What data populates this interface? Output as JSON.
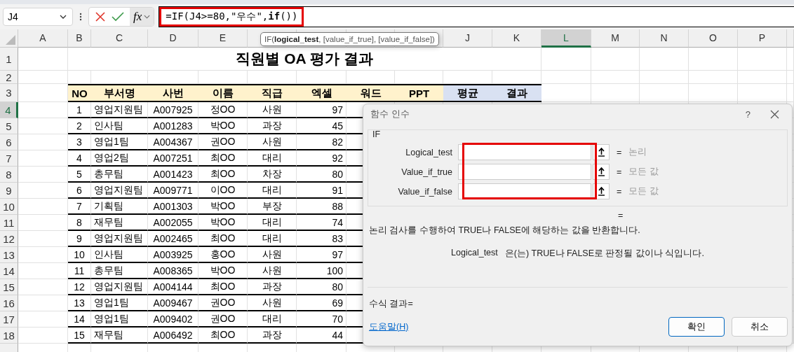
{
  "name_box": {
    "value": "J4"
  },
  "formula_bar": {
    "fx_label": "fx",
    "formula": "=IF(J4>=80,\"우수\",**if**())",
    "highlighted": true
  },
  "tooltip": {
    "text": "IF(**logical_test**, [value_if_true], [value_if_false])"
  },
  "column_headers_left": [
    {
      "label": "A",
      "selected": false
    },
    {
      "label": "B",
      "selected": false
    },
    {
      "label": "C",
      "selected": false
    },
    {
      "label": "D",
      "selected": false
    },
    {
      "label": "E",
      "selected": false
    }
  ],
  "column_headers_right": [
    {
      "label": "J",
      "selected": false
    },
    {
      "label": "K",
      "selected": false
    },
    {
      "label": "L",
      "selected": true
    },
    {
      "label": "M",
      "selected": false
    },
    {
      "label": "N",
      "selected": false
    },
    {
      "label": "O",
      "selected": false
    },
    {
      "label": "P",
      "selected": false
    }
  ],
  "rows": [
    {
      "number": "1",
      "selected": false,
      "kind": "title",
      "title": "직원별 OA 평가 결과"
    },
    {
      "number": "2",
      "selected": false,
      "kind": "blank"
    },
    {
      "number": "3",
      "selected": false,
      "kind": "header",
      "cells": [
        {
          "text": "NO",
          "color": "#fff2cc"
        },
        {
          "text": "부서명",
          "color": "#fff2cc"
        },
        {
          "text": "사번",
          "color": "#fff2cc"
        },
        {
          "text": "이름",
          "color": "#fff2cc"
        },
        {
          "text": "직급",
          "color": "#fff2cc"
        },
        {
          "text": "엑셀",
          "color": "#fff2cc"
        },
        {
          "text": "워드",
          "color": "#fff2cc"
        },
        {
          "text": "PPT",
          "color": "#fff2cc"
        },
        {
          "text": "평균",
          "color": "#d9e1f2"
        },
        {
          "text": "결과",
          "color": "#d9e1f2"
        }
      ]
    },
    {
      "number": "4",
      "selected": true,
      "kind": "data",
      "cells": [
        "1",
        "영업지원팀",
        "A007925",
        "정OO",
        "사원",
        "97"
      ]
    },
    {
      "number": "5",
      "selected": false,
      "kind": "data",
      "cells": [
        "2",
        "인사팀",
        "A001283",
        "박OO",
        "과장",
        "45"
      ]
    },
    {
      "number": "6",
      "selected": false,
      "kind": "data",
      "cells": [
        "3",
        "영업1팀",
        "A004367",
        "권OO",
        "사원",
        "82"
      ]
    },
    {
      "number": "7",
      "selected": false,
      "kind": "data",
      "cells": [
        "4",
        "영업2팀",
        "A007251",
        "최OO",
        "대리",
        "92"
      ]
    },
    {
      "number": "8",
      "selected": false,
      "kind": "data",
      "cells": [
        "5",
        "총무팀",
        "A001423",
        "최OO",
        "차장",
        "80"
      ]
    },
    {
      "number": "9",
      "selected": false,
      "kind": "data",
      "cells": [
        "6",
        "영업지원팀",
        "A009771",
        "이OO",
        "대리",
        "91"
      ]
    },
    {
      "number": "10",
      "selected": false,
      "kind": "data",
      "cells": [
        "7",
        "기획팀",
        "A001303",
        "박OO",
        "부장",
        "88"
      ]
    },
    {
      "number": "11",
      "selected": false,
      "kind": "data",
      "cells": [
        "8",
        "재무팀",
        "A002055",
        "박OO",
        "대리",
        "74"
      ]
    },
    {
      "number": "12",
      "selected": false,
      "kind": "data",
      "cells": [
        "9",
        "영업지원팀",
        "A002465",
        "최OO",
        "대리",
        "83"
      ]
    },
    {
      "number": "13",
      "selected": false,
      "kind": "data",
      "cells": [
        "10",
        "인사팀",
        "A003925",
        "홍OO",
        "사원",
        "97"
      ]
    },
    {
      "number": "14",
      "selected": false,
      "kind": "data",
      "cells": [
        "11",
        "총무팀",
        "A008365",
        "박OO",
        "사원",
        "100"
      ]
    },
    {
      "number": "15",
      "selected": false,
      "kind": "data",
      "cells": [
        "12",
        "영업지원팀",
        "A004144",
        "최OO",
        "과장",
        "80"
      ]
    },
    {
      "number": "16",
      "selected": false,
      "kind": "data",
      "cells": [
        "13",
        "영업1팀",
        "A009467",
        "권OO",
        "사원",
        "69"
      ]
    },
    {
      "number": "17",
      "selected": false,
      "kind": "data",
      "cells": [
        "14",
        "영업1팀",
        "A009402",
        "권OO",
        "대리",
        "70"
      ]
    },
    {
      "number": "18",
      "selected": false,
      "kind": "data",
      "cells": [
        "15",
        "재무팀",
        "A006492",
        "최OO",
        "과장",
        "44"
      ]
    }
  ],
  "dialog": {
    "title": "함수 인수",
    "help": "?",
    "function_name": "IF",
    "fields_highlighted": true,
    "arguments": [
      {
        "label": "Logical_test",
        "equals": "=",
        "hint": "논리"
      },
      {
        "label": "Value_if_true",
        "equals": "=",
        "hint": "모든 값"
      },
      {
        "label": "Value_if_false",
        "equals": "=",
        "hint": "모든 값"
      }
    ],
    "result_equals": "=",
    "description": "논리 검사를 수행하여 TRUE나 FALSE에 해당하는 값을 반환합니다.",
    "argument_help": {
      "name": "Logical_test",
      "text": "은(는) TRUE나 FALSE로 판정될 값이나 식입니다."
    },
    "formula_result": "수식 결과=",
    "help_link": "도움말(H)",
    "buttons": [
      {
        "label": "확인",
        "default": true
      },
      {
        "label": "취소",
        "default": false
      }
    ]
  }
}
